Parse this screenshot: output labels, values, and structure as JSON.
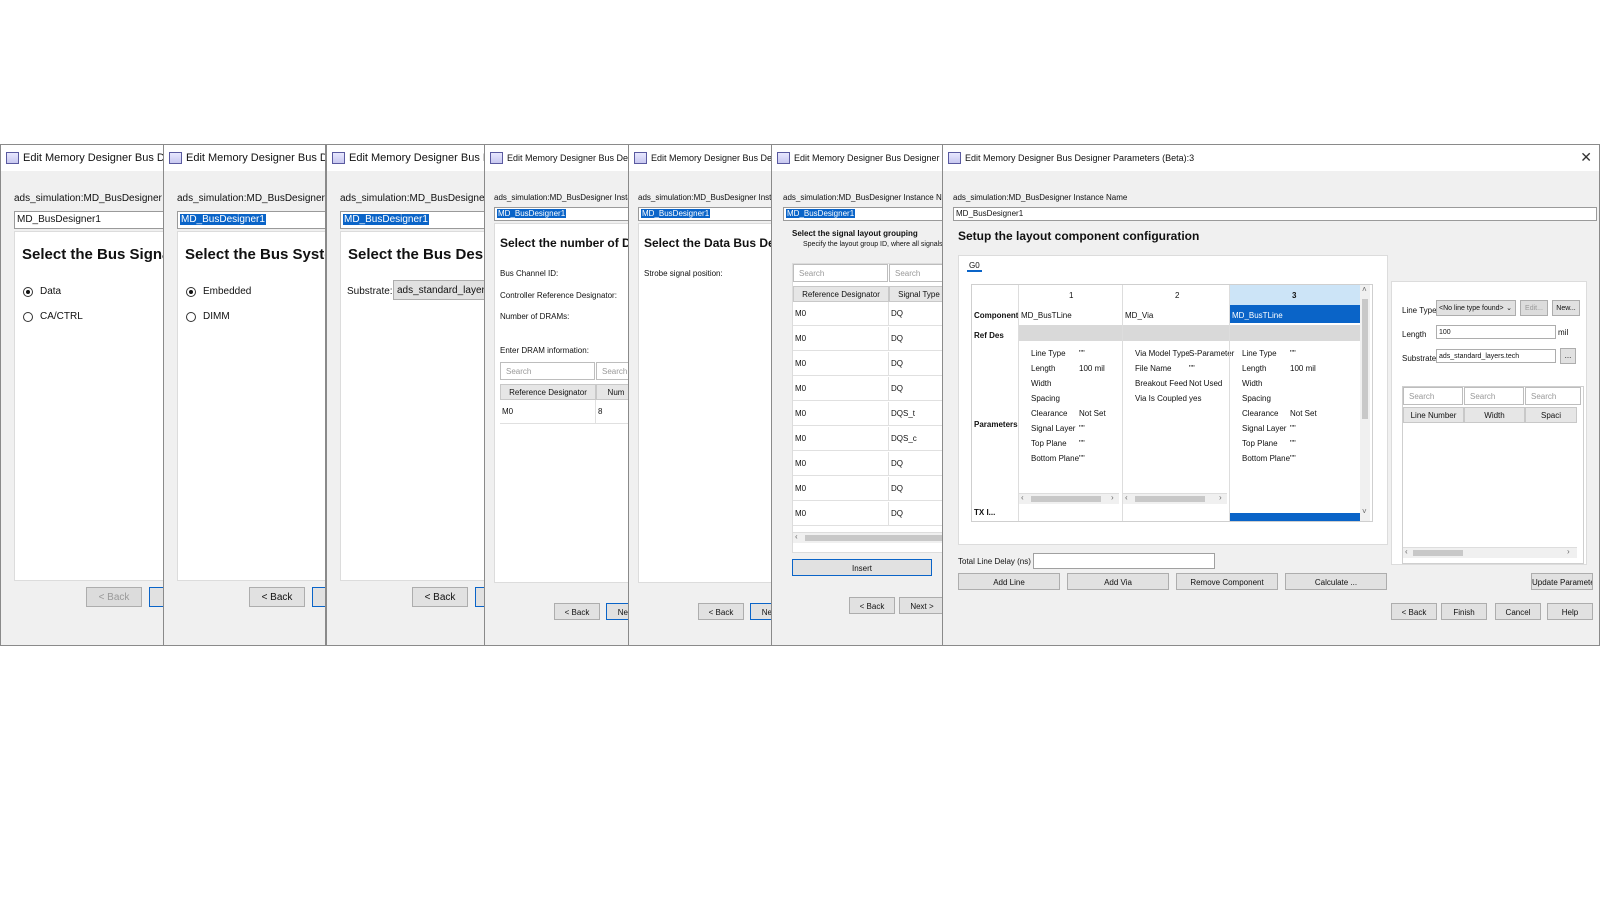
{
  "dialog_title": "Edit Memory Designer Bus Designer Parameters (Beta):3",
  "instance_label": "ads_simulation:MD_BusDesigner Instance Name",
  "instance_value": "MD_BusDesigner1",
  "buttons": {
    "back": "< Back",
    "next": "Next >",
    "next_short": "Next",
    "finish": "Finish",
    "cancel": "Cancel",
    "help": "Help"
  },
  "search_placeholder": "Search",
  "step1": {
    "heading": "Select the Bus Signal type",
    "options": [
      {
        "label": "Data",
        "selected": true
      },
      {
        "label": "CA/CTRL",
        "selected": false
      }
    ]
  },
  "step2": {
    "heading": "Select the Bus System",
    "options": [
      {
        "label": "Embedded",
        "selected": true
      },
      {
        "label": "DIMM",
        "selected": false
      }
    ]
  },
  "step3": {
    "heading": "Select the Bus Designer",
    "substrate_label": "Substrate:",
    "substrate_value": "ads_standard_layers:tech"
  },
  "step4": {
    "heading": "Select the number of DRAMs",
    "fields": [
      "Bus Channel ID:",
      "Controller Reference Designator:",
      "Number of DRAMs:"
    ],
    "enter_info": "Enter DRAM information:",
    "columns": [
      "Reference Designator",
      "Num"
    ],
    "rows": [
      [
        "M0",
        "8"
      ]
    ]
  },
  "step5": {
    "heading": "Select the Data Bus Designer",
    "strobe_label": "Strobe signal position:"
  },
  "step6": {
    "heading": "Select the signal layout grouping",
    "subtitle": "Specify the layout group ID, where all signals",
    "columns": [
      "Reference Designator",
      "Signal Type"
    ],
    "rows": [
      [
        "M0",
        "DQ"
      ],
      [
        "M0",
        "DQ"
      ],
      [
        "M0",
        "DQ"
      ],
      [
        "M0",
        "DQ"
      ],
      [
        "M0",
        "DQS_t"
      ],
      [
        "M0",
        "DQS_c"
      ],
      [
        "M0",
        "DQ"
      ],
      [
        "M0",
        "DQ"
      ],
      [
        "M0",
        "DQ"
      ]
    ],
    "insert_label": "Insert"
  },
  "step7": {
    "heading": "Setup the layout component configuration",
    "tab": "G0",
    "row_labels": [
      "Component",
      "Ref Des",
      "Parameters",
      "TX I..."
    ],
    "columns": [
      {
        "num": "1",
        "component": "MD_BusTLine",
        "params": [
          [
            "Line Type",
            "\"\""
          ],
          [
            "Length",
            "100 mil"
          ],
          [
            "Width",
            ""
          ],
          [
            "Spacing",
            ""
          ],
          [
            "Clearance",
            "Not Set"
          ],
          [
            "Signal Layer",
            "\"\""
          ],
          [
            "Top Plane",
            "\"\""
          ],
          [
            "Bottom Plane",
            "\"\""
          ]
        ]
      },
      {
        "num": "2",
        "component": "MD_Via",
        "params": [
          [
            "Via Model Type",
            "S-Parameter"
          ],
          [
            "File Name",
            "\"\""
          ],
          [
            "Breakout Feed",
            "Not Used"
          ],
          [
            "Via Is Coupled",
            "yes"
          ]
        ]
      },
      {
        "num": "3",
        "component": "MD_BusTLine",
        "params": [
          [
            "Line Type",
            "\"\""
          ],
          [
            "Length",
            "100 mil"
          ],
          [
            "Width",
            ""
          ],
          [
            "Spacing",
            ""
          ],
          [
            "Clearance",
            "Not Set"
          ],
          [
            "Signal Layer",
            "\"\""
          ],
          [
            "Top Plane",
            "\"\""
          ],
          [
            "Bottom Plane",
            "\"\""
          ]
        ]
      }
    ],
    "total_delay_label": "Total Line Delay (ns) :",
    "actions": [
      "Add Line",
      "Add Via",
      "Remove Component",
      "Calculate ..."
    ],
    "side": {
      "line_type_label": "Line Type",
      "line_type_value": "<No line type found>",
      "edit_label": "Edit...",
      "new_label": "New...",
      "length_label": "Length",
      "length_value": "100",
      "length_unit": "mil",
      "substrate_label": "Substrate",
      "substrate_value": "ads_standard_layers.tech",
      "ellipsis": "...",
      "columns": [
        "Line Number",
        "Width",
        "Spaci"
      ],
      "update_label": "Update Parameters"
    }
  }
}
